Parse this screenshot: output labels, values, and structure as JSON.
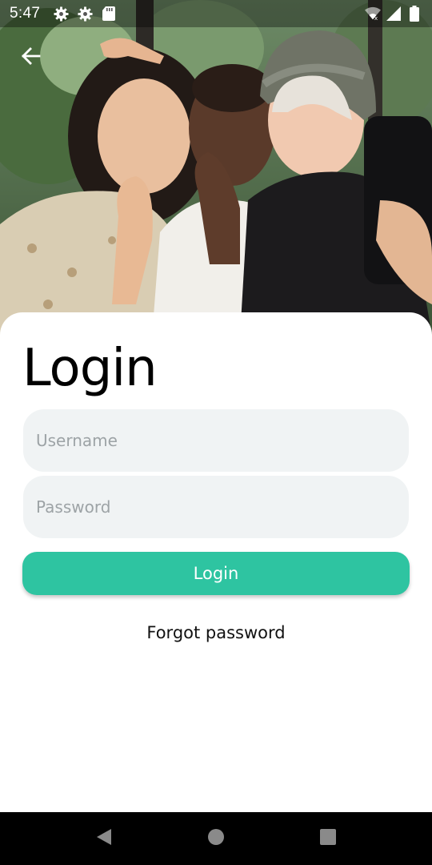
{
  "status_bar": {
    "time": "5:47",
    "left_icons": [
      "gear-icon",
      "gear-icon",
      "sd-card-icon"
    ],
    "right_icons": [
      "wifi-icon",
      "signal-icon",
      "battery-icon"
    ]
  },
  "header": {
    "back_icon": "arrow-left-icon"
  },
  "login_form": {
    "title": "Login",
    "username_placeholder": "Username",
    "username_value": "",
    "password_placeholder": "Password",
    "password_value": "",
    "submit_label": "Login",
    "forgot_label": "Forgot password"
  },
  "nav_bar": {
    "buttons": [
      "back-triangle-icon",
      "home-circle-icon",
      "recents-square-icon"
    ]
  },
  "colors": {
    "accent": "#2ec4a1",
    "field_background": "#f0f3f4",
    "placeholder": "#9da3a6",
    "nav_background": "#000000"
  }
}
